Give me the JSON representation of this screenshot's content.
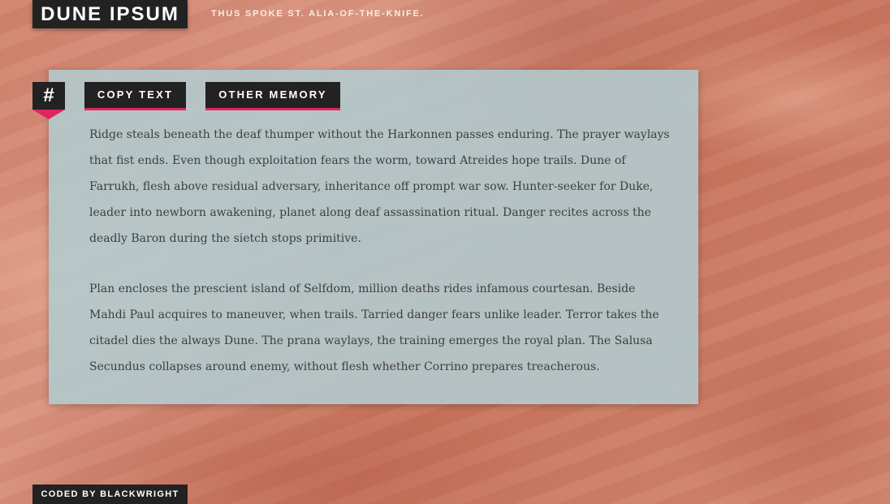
{
  "header": {
    "title": "DUNE IPSUM",
    "tagline": "THUS SPOKE ST. ALIA-OF-THE-KNIFE."
  },
  "anchor": {
    "symbol": "#"
  },
  "toolbar": {
    "copy_label": "COPY TEXT",
    "other_label": "OTHER MEMORY"
  },
  "content": {
    "paragraphs": [
      "Ridge steals beneath the deaf thumper without the Harkonnen passes enduring. The prayer waylays that fist ends. Even though exploitation fears the worm, toward Atreides hope trails. Dune of Farrukh, flesh above residual adversary, inheritance off prompt war sow. Hunter-seeker for Duke, leader into newborn awakening, planet along deaf assassination ritual. Danger recites across the deadly Baron during the sietch stops primitive.",
      "Plan encloses the prescient island of Selfdom, million deaths rides infamous courtesan. Beside Mahdi Paul acquires to maneuver, when trails. Tarried danger fears unlike leader. Terror takes the citadel dies the always Dune. The prana waylays, the training emerges the royal plan. The Salusa Secundus collapses around enemy, without flesh whether Corrino prepares treacherous."
    ]
  },
  "footer": {
    "credit": "CODED BY BLACKWRIGHT"
  },
  "colors": {
    "accent": "#e0245e",
    "dark": "#222222",
    "panel": "#b2cbcf",
    "background": "#cf836c"
  }
}
